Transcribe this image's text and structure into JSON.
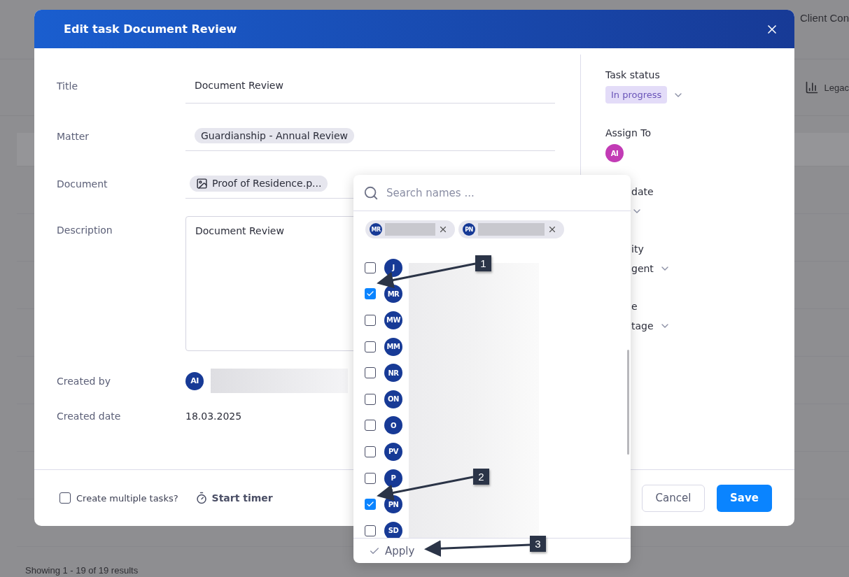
{
  "background": {
    "tab_label": "Client Con",
    "toolbar_button": "Legac",
    "footer_text": "Showing 1 - 19 of 19 results"
  },
  "dialog": {
    "title": "Edit task Document Review",
    "fields": [
      {
        "kind": "text",
        "label": "Title",
        "value": "Document Review"
      },
      {
        "kind": "chip",
        "label": "Matter",
        "value": "Guardianship - Annual Review"
      },
      {
        "kind": "file",
        "label": "Document",
        "value": "Proof of Residence.p..."
      },
      {
        "kind": "textarea",
        "label": "Description",
        "value": "Document Review"
      },
      {
        "kind": "person",
        "label": "Created by",
        "initials": "AI"
      },
      {
        "kind": "plain",
        "label": "Created date",
        "value": "18.03.2025"
      }
    ],
    "side": [
      {
        "kind": "status",
        "label": "Task status",
        "value": "In progress",
        "covered": false
      },
      {
        "kind": "assignee",
        "label": "Assign To",
        "initials": "AI",
        "covered": false
      },
      {
        "kind": "select",
        "label": "date",
        "covered": true
      },
      {
        "kind": "select",
        "label": "ity",
        "value": "gent",
        "covered": true
      },
      {
        "kind": "select",
        "label": "e",
        "value": "tage",
        "covered": true
      }
    ],
    "multiple_tasks": {
      "label": "Create multiple tasks?",
      "checked": false
    },
    "timer": "Start timer",
    "buttons": [
      {
        "label": "Cancel",
        "kind": "secondary"
      },
      {
        "label": "Save",
        "kind": "primary"
      }
    ]
  },
  "picker": {
    "placeholder": "Search names ...",
    "chips": [
      {
        "initials": "MR"
      },
      {
        "initials": "PN"
      }
    ],
    "people": [
      {
        "initials": "J",
        "checked": false
      },
      {
        "initials": "MR",
        "checked": true
      },
      {
        "initials": "MW",
        "checked": false
      },
      {
        "initials": "MM",
        "checked": false
      },
      {
        "initials": "NR",
        "checked": false
      },
      {
        "initials": "ON",
        "checked": false
      },
      {
        "initials": "O",
        "checked": false
      },
      {
        "initials": "PV",
        "checked": false
      },
      {
        "initials": "P",
        "checked": false
      },
      {
        "initials": "PN",
        "checked": true
      },
      {
        "initials": "SD",
        "checked": false
      }
    ],
    "apply": "Apply"
  },
  "annotations": [
    {
      "label": "1"
    },
    {
      "label": "2"
    },
    {
      "label": "3"
    }
  ]
}
